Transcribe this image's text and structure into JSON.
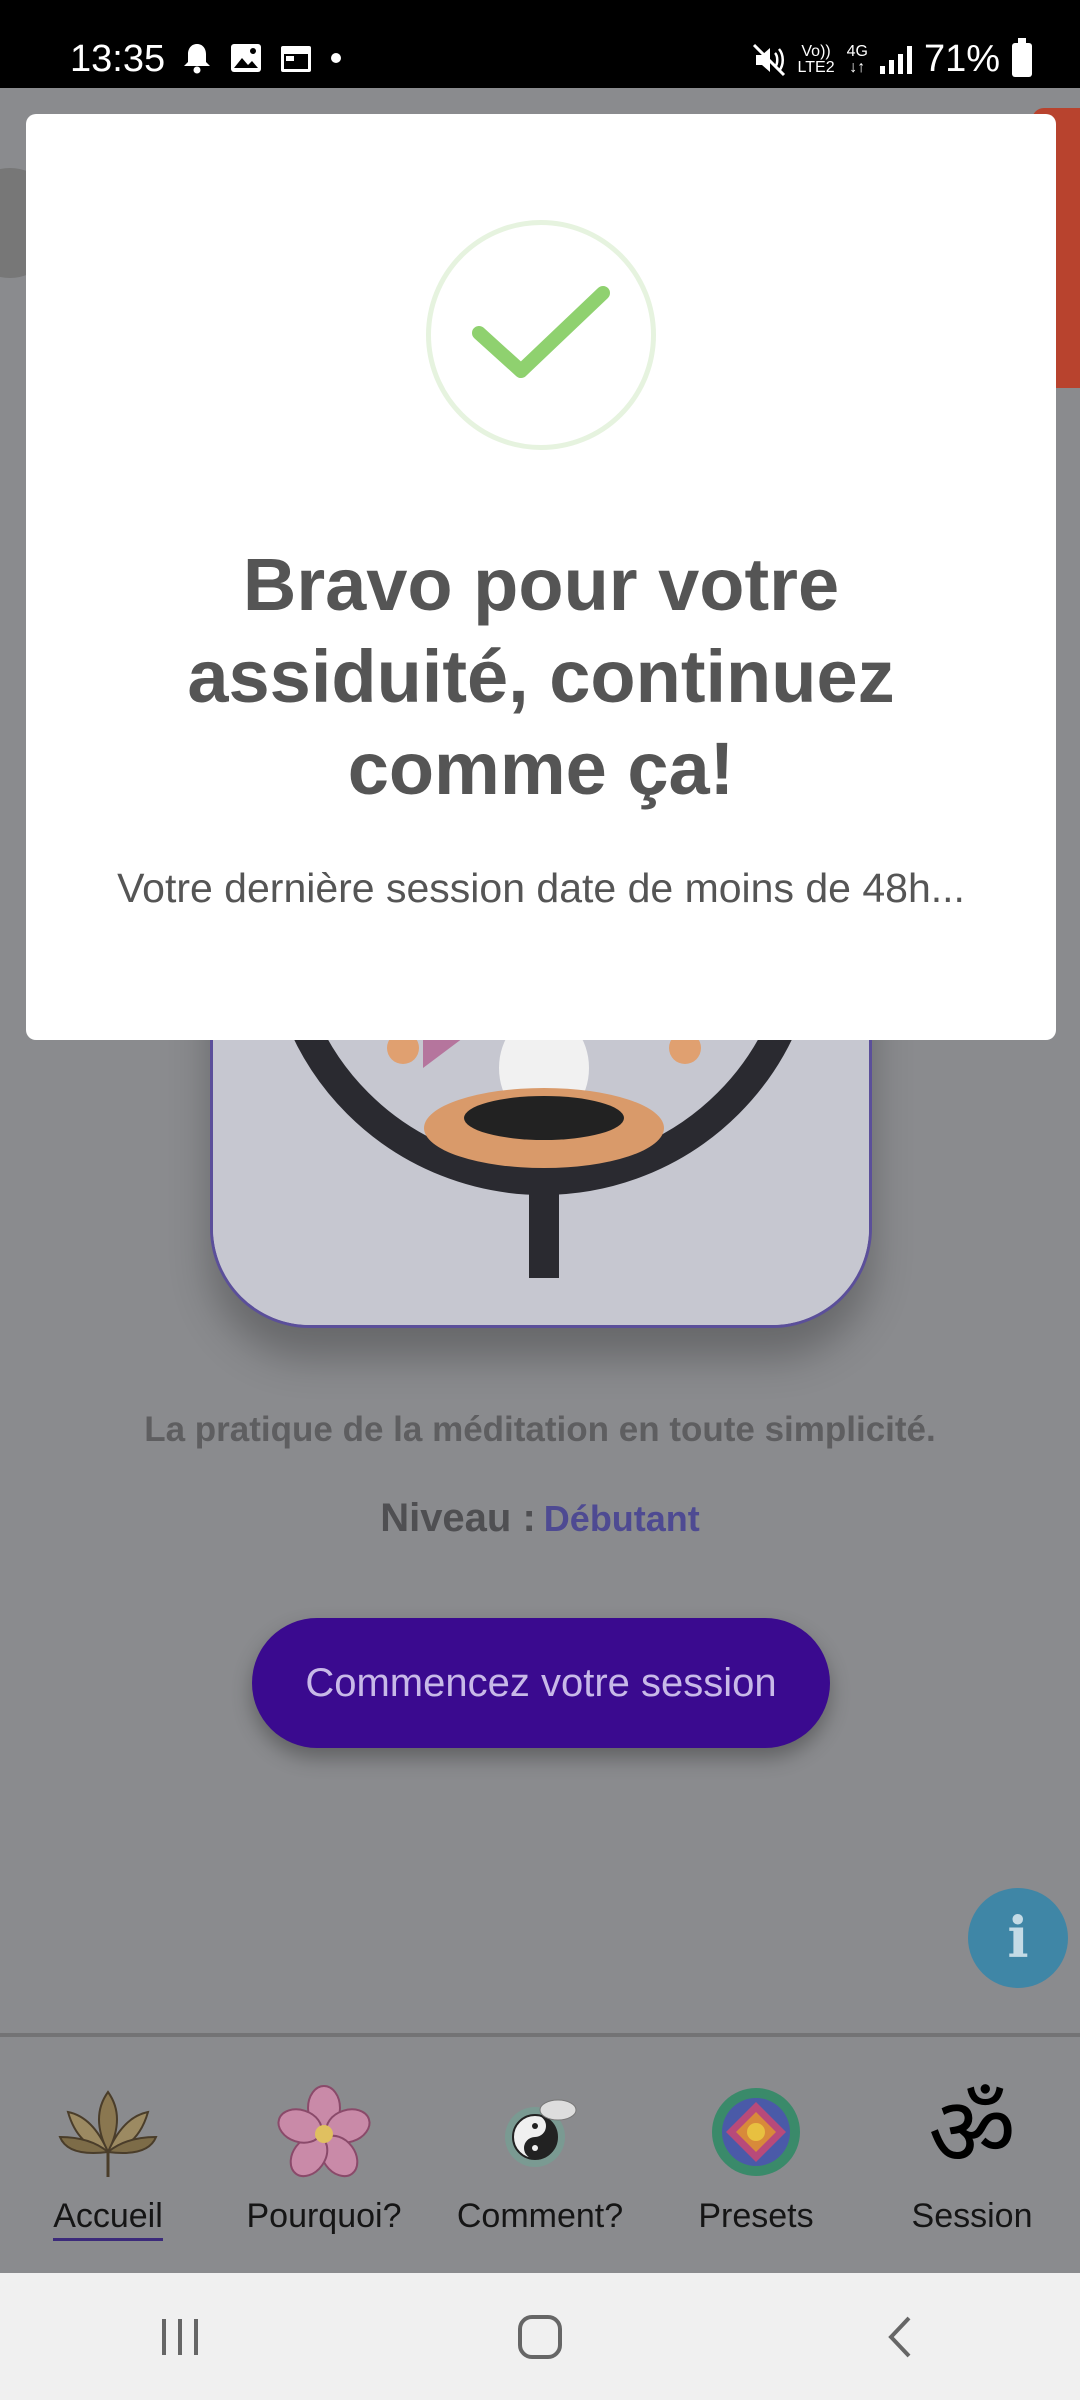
{
  "status_bar": {
    "time": "13:35",
    "network_top": "Vo))",
    "network_bottom": "LTE2",
    "data_top": "4G",
    "data_bottom": "↓↑",
    "battery": "71%"
  },
  "home": {
    "tagline": "La pratique de la méditation en toute simplicité.",
    "level_label": "Niveau :",
    "level_value": "Débutant",
    "start_button": "Commencez votre session",
    "info_icon_glyph": "i"
  },
  "tabs": [
    {
      "label": "Accueil",
      "icon": "lotus-icon",
      "active": true
    },
    {
      "label": "Pourquoi?",
      "icon": "flower-icon",
      "active": false
    },
    {
      "label": "Comment?",
      "icon": "yin-yang-icon",
      "active": false
    },
    {
      "label": "Presets",
      "icon": "mandala-icon",
      "active": false
    },
    {
      "label": "Session",
      "icon": "om-icon",
      "active": false
    }
  ],
  "session_glyph": "ॐ",
  "modal": {
    "title": "Bravo pour votre assiduité, continuez comme ça!",
    "text": "Votre dernière session date de moins de 48h...",
    "icon": "checkmark-icon"
  },
  "colors": {
    "accent": "#3a0a8f",
    "check": "#8fd16f",
    "level": "#4e4a92"
  }
}
